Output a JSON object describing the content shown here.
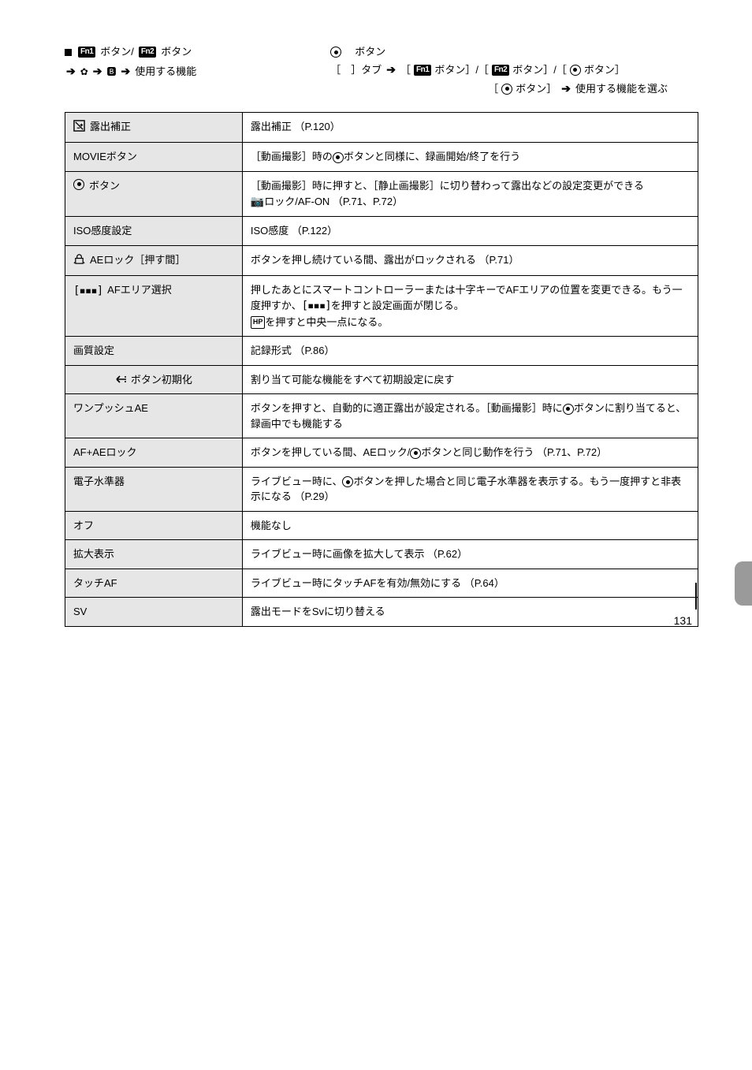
{
  "intro": {
    "left_label_prefix": "　　ボタン/　　ボタン",
    "left_seq_suffix": "使用する機能",
    "right_l1": "　ボタン",
    "right_l2_prefix": "［　］",
    "right_l2_rest": "タブ　　［　　ボタン］/［　　ボタン］/［　ボタン］",
    "right_l3": "　　　［　ボタン］　　使用する機能を選ぶ"
  },
  "rows": [
    {
      "label_icon": "expcomp",
      "label": "露出補正",
      "desc": "露出補正 （P.120）"
    },
    {
      "label_icon": "",
      "label": "MOVIEボタン",
      "desc": "［動画撮影］時の　ボタンと同様に、録画開始/終了を行う"
    },
    {
      "label_icon": "target",
      "label": "ボタン",
      "desc": "［動画撮影］時に押すと、［静止画撮影］に切り替わって露出などの設定変更ができる　　ロック/AF-ON （P.71、P.72）"
    },
    {
      "label_icon": "",
      "label": "ISO感度設定",
      "desc": "ISO感度 （P.122）"
    },
    {
      "label_icon": "lock",
      "label": "AEロック［押す間］",
      "desc": "ボタンを押し続けている間、露出がロックされる （P.71）"
    },
    {
      "label_icon": "af",
      "label": "AFエリア選択",
      "desc": "押したあとにスマートコントローラーまたは十字キーでAFエリアの位置を変更できる。もう一度押すか、　　を押すと設定画面が閉じる。　　　　を押すと中央一点になる。"
    },
    {
      "label_icon": "",
      "label": "画質設定",
      "desc": "記録形式 （P.86）"
    },
    {
      "label_icon": "nwarrow",
      "label": "　ボタン初期化",
      "desc": "割り当て可能な機能をすべて初期設定に戻す"
    },
    {
      "label_icon": "",
      "label": "ワンプッシュAE",
      "desc": "ボタンを押すと、自動的に適正露出が設定される。［動画撮影］時に　ボタンに割り当てると、録画中でも機能する"
    },
    {
      "label_icon": "",
      "label": "AF+AEロック",
      "desc": "ボタンを押している間、AEロック/　ボタンと同じ動作を行う （P.71、P.72）"
    },
    {
      "label_icon": "",
      "label": "電子水準器",
      "desc": "ライブビュー時に、　ボタンを押した場合と同じ電子水準器を表示する。もう一度押すと非表示になる （P.29）"
    },
    {
      "label_icon": "",
      "label": "オフ",
      "desc": "機能なし"
    },
    {
      "label_icon": "",
      "label": "拡大表示",
      "desc": "ライブビュー時に画像を拡大して表示 （P.62）"
    },
    {
      "label_icon": "",
      "label": "タッチAF",
      "desc": "ライブビュー時にタッチAFを有効/無効にする （P.64）"
    },
    {
      "label_icon": "",
      "label": "SV",
      "desc": "露出モードをSvに切り替える"
    }
  ],
  "page_number": "131"
}
